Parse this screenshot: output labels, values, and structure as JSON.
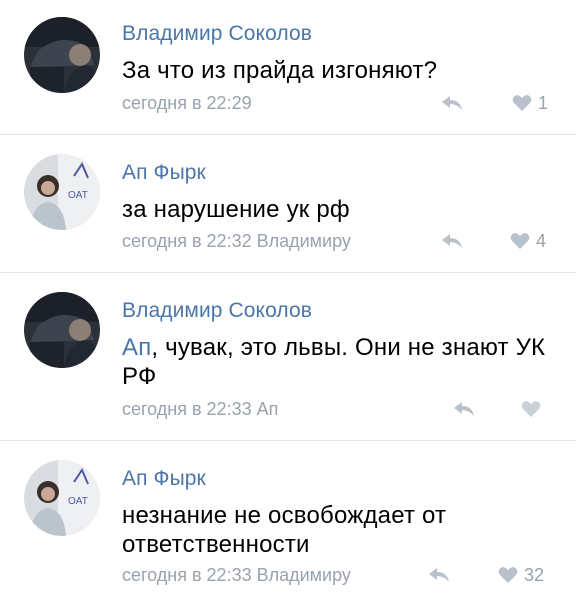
{
  "comments": [
    {
      "author": "Владимир Соколов",
      "text_before": "",
      "mention": "",
      "text": "За что из прайда изгоняют?",
      "meta": "сегодня в 22:29",
      "likes": "1",
      "avatar": "dark-car-photo"
    },
    {
      "author": "Ап Фырк",
      "text_before": "",
      "mention": "",
      "text": "за нарушение ук рф",
      "meta": "сегодня в 22:32 Владимиру",
      "likes": "4",
      "avatar": "person-whiteboard-photo"
    },
    {
      "author": "Владимир Соколов",
      "mention": "Ап",
      "text": ", чувак, это львы. Они не знают УК РФ",
      "meta": "сегодня в 22:33 Ап",
      "likes": "",
      "avatar": "dark-car-photo"
    },
    {
      "author": "Ап Фырк",
      "mention": "",
      "text": "незнание не освобождает от ответственности",
      "meta": "сегодня в 22:33 Владимиру",
      "likes": "32",
      "avatar": "person-whiteboard-photo"
    }
  ],
  "icons": {
    "reply": "reply-arrow-icon",
    "like": "heart-icon"
  },
  "colors": {
    "link": "#4a76a8",
    "meta": "#99a2ad",
    "divider": "#e3e5e8"
  }
}
